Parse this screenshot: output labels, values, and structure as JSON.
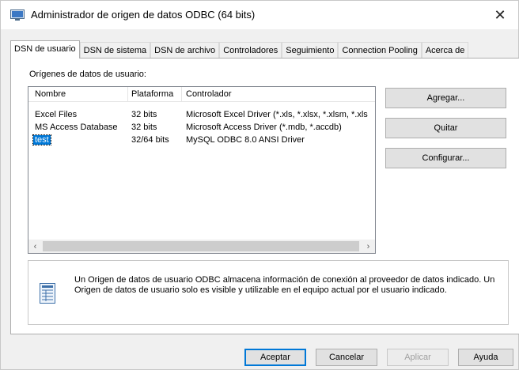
{
  "window": {
    "title": "Administrador de origen de datos ODBC (64 bits)",
    "close_glyph": "✕"
  },
  "tabs": [
    {
      "label": "DSN de usuario",
      "active": true
    },
    {
      "label": "DSN de sistema"
    },
    {
      "label": "DSN de archivo"
    },
    {
      "label": "Controladores"
    },
    {
      "label": "Seguimiento"
    },
    {
      "label": "Connection Pooling"
    },
    {
      "label": "Acerca de"
    }
  ],
  "list": {
    "section_label": "Orígenes de datos de usuario:",
    "columns": [
      "Nombre",
      "Plataforma",
      "Controlador"
    ],
    "rows": [
      {
        "name": "Excel Files",
        "platform": "32 bits",
        "driver": "Microsoft Excel Driver (*.xls, *.xlsx, *.xlsm, *.xls"
      },
      {
        "name": "MS Access Database",
        "platform": "32 bits",
        "driver": "Microsoft Access Driver (*.mdb, *.accdb)"
      },
      {
        "name": "test",
        "platform": "32/64 bits",
        "driver": "MySQL ODBC 8.0 ANSI Driver",
        "selected": true
      }
    ],
    "scroll_left": "‹",
    "scroll_right": "›"
  },
  "side_buttons": {
    "add": "Agregar...",
    "remove": "Quitar",
    "configure": "Configurar..."
  },
  "info": {
    "text": "Un Origen de datos de usuario ODBC almacena información de conexión al proveedor de datos indicado. Un Origen de datos de usuario solo es visible y utilizable en el equipo actual por el usuario indicado."
  },
  "footer": {
    "ok": "Aceptar",
    "cancel": "Cancelar",
    "apply": "Aplicar",
    "help": "Ayuda"
  },
  "colors": {
    "selection": "#0078d7",
    "window_bg": "#f0f0f0"
  }
}
